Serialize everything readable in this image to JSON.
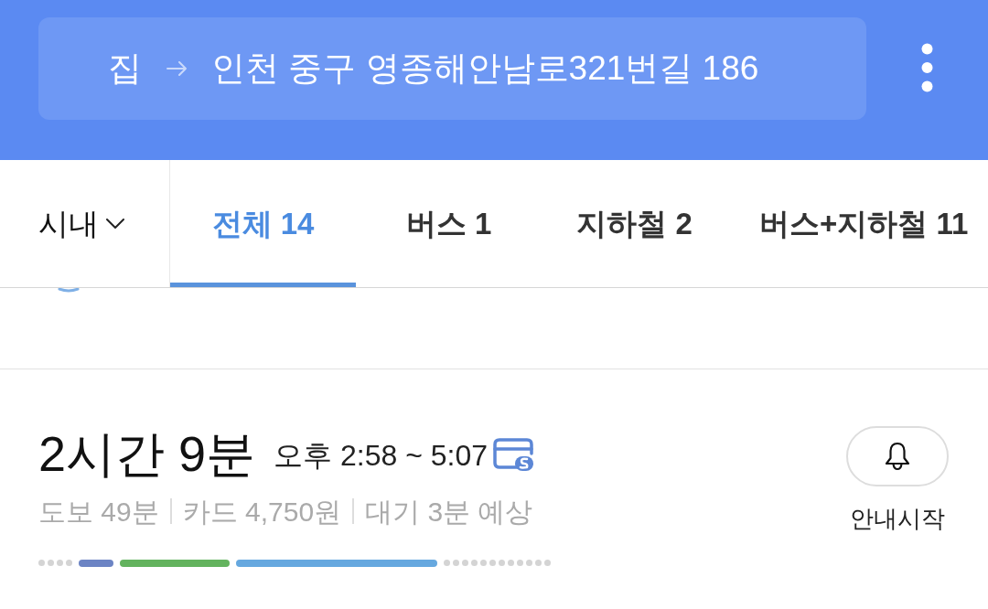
{
  "header": {
    "origin": "집",
    "destination": "인천 중구 영종해안남로321번길 186"
  },
  "filter": {
    "label": "시내"
  },
  "tabs": [
    {
      "label": "전체 14",
      "selected": true
    },
    {
      "label": "버스 1",
      "selected": false
    },
    {
      "label": "지하철 2",
      "selected": false
    },
    {
      "label": "버스+지하철 11",
      "selected": false
    }
  ],
  "route": {
    "duration": "2시간 9분",
    "time_range": "오후 2:58 ~ 5:07",
    "summary": [
      "도보 49분",
      "카드 4,750원",
      "대기 3분 예상"
    ],
    "segments": [
      {
        "kind": "walk"
      },
      {
        "kind": "ride",
        "color": "#6c84c4"
      },
      {
        "kind": "ride",
        "color": "#63b35e"
      },
      {
        "kind": "ride",
        "color": "#66a8df"
      },
      {
        "kind": "walk"
      }
    ],
    "alert_label": "안내시작"
  }
}
